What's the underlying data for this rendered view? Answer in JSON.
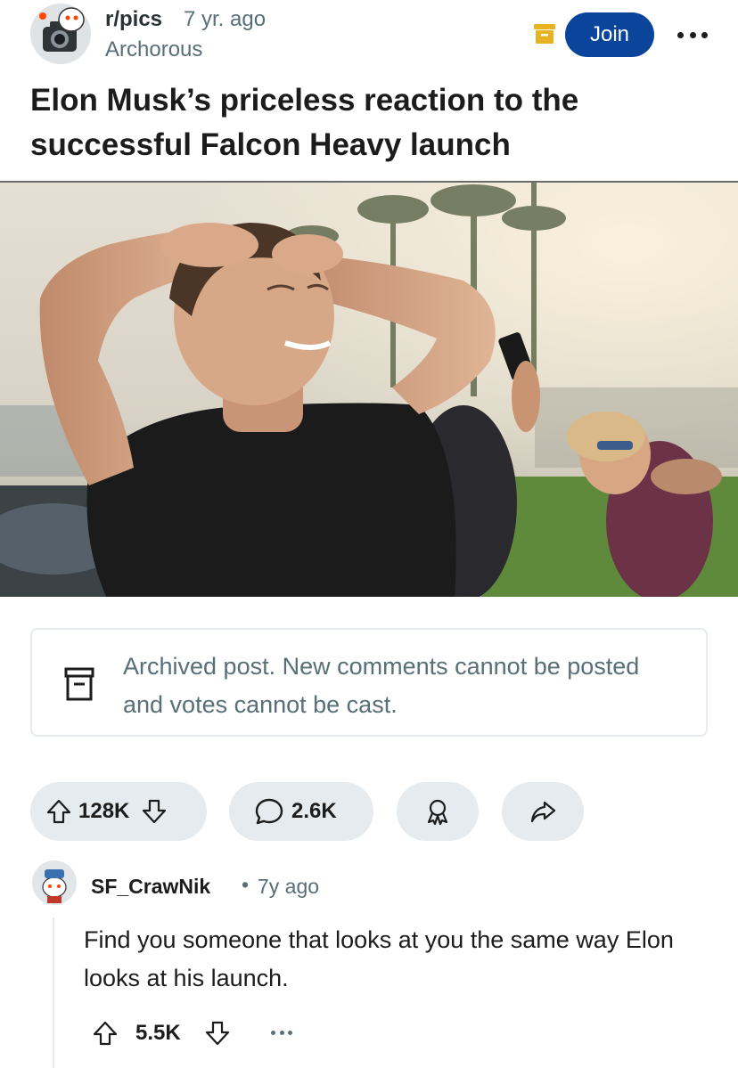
{
  "post": {
    "subreddit": "r/pics",
    "age": "7 yr. ago",
    "author": "Archorous",
    "join_label": "Join",
    "title": "Elon Musk’s priceless reaction to the successful Falcon Heavy launch",
    "archived_notice": "Archived post. New comments cannot be posted and votes cannot be cast.",
    "votes": "128K",
    "comments": "2.6K"
  },
  "comment": {
    "user": "SF_CrawNik",
    "separator": "•",
    "age": "7y ago",
    "body": "Find you someone that looks at you the same way Elon looks at his launch.",
    "score": "5.5K"
  },
  "icons": {
    "archive_badge": "archive-box-icon",
    "more": "ellipsis-icon",
    "upvote": "upvote-arrow-icon",
    "downvote": "downvote-arrow-icon",
    "comment": "speech-bubble-icon",
    "award": "award-ribbon-icon",
    "share": "share-arrow-icon"
  },
  "colors": {
    "join_button": "#0a449b",
    "archive_badge": "#e8b323",
    "pill_background": "#e5ebee",
    "muted_text": "#576f76"
  }
}
